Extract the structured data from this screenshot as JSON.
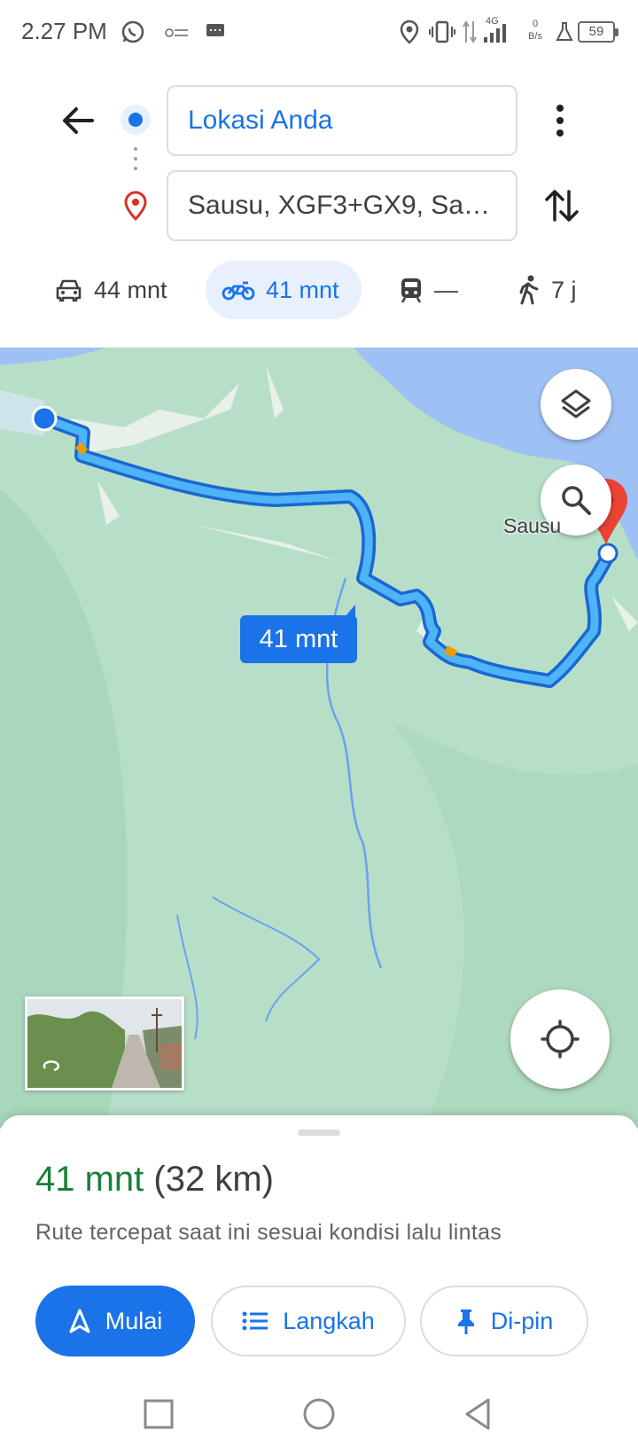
{
  "status_bar": {
    "time": "2.27 PM",
    "network_label": "4G",
    "net_speed_value": "0",
    "net_speed_unit": "B/s",
    "battery": "59",
    "icons": [
      "whatsapp-icon",
      "app-icon",
      "message-icon",
      "location-icon",
      "vibrate-icon",
      "signal-icon",
      "lab-icon",
      "battery-icon"
    ]
  },
  "header": {
    "origin": "Lokasi Anda",
    "destination": "Sausu, XGF3+GX9, Sau..."
  },
  "modes": [
    {
      "icon": "car-icon",
      "label": "44 mnt",
      "selected": false
    },
    {
      "icon": "motorcycle-icon",
      "label": "41 mnt",
      "selected": true
    },
    {
      "icon": "transit-icon",
      "label": "—",
      "selected": false
    },
    {
      "icon": "walk-icon",
      "label": "7 j",
      "selected": false
    }
  ],
  "map": {
    "place_label": "Sausu",
    "route_callout": "41 mnt",
    "colors": {
      "land": "#b7dfc7",
      "water": "#9ec1f5",
      "route": "#1a73e8",
      "route_light": "#4fb3f7",
      "traffic": "#f29900",
      "pin": "#ea4335"
    }
  },
  "summary": {
    "duration": "41 mnt",
    "distance": "(32 km)",
    "subtitle": "Rute tercepat saat ini sesuai kondisi lalu lintas"
  },
  "actions": {
    "start": "Mulai",
    "steps": "Langkah",
    "pin": "Di-pin"
  }
}
